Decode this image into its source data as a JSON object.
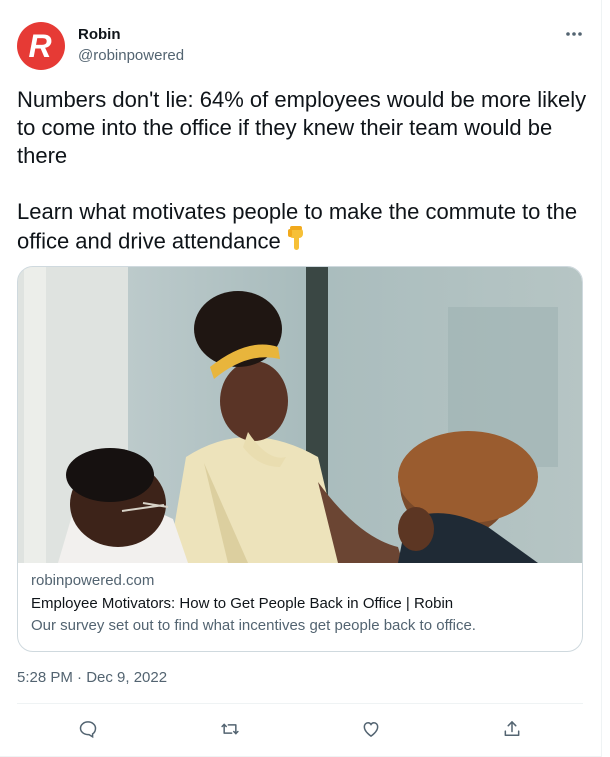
{
  "author": {
    "avatar_letter": "R",
    "avatar_color": "#e63a35",
    "name": "Robin",
    "handle": "@robinpowered"
  },
  "tweet": {
    "text": "Numbers don't lie: 64% of employees would be more likely to come into the office if they knew their team would be there\n\nLearn what motivates people to make the commute to the office and drive attendance",
    "emoji": "backhand-index-pointing-down"
  },
  "link_card": {
    "domain": "robinpowered.com",
    "title": "Employee Motivators: How to Get People Back in Office | Robin",
    "description": "Our survey set out to find what incentives get people back to office."
  },
  "timestamp": "5:28 PM · Dec 9, 2022",
  "actions": [
    "reply-icon",
    "retweet-icon",
    "like-icon",
    "share-icon"
  ],
  "colors": {
    "text": "#0f1419",
    "muted": "#536471",
    "border": "#cfd9de"
  }
}
